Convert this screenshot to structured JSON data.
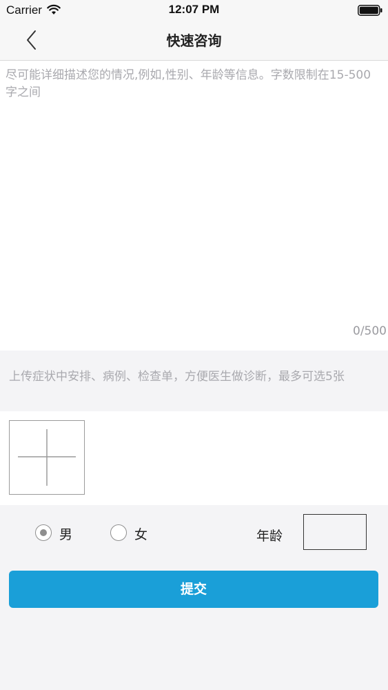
{
  "status_bar": {
    "carrier": "Carrier",
    "time": "12:07 PM"
  },
  "nav": {
    "title": "快速咨询"
  },
  "description": {
    "placeholder": "尽可能详细描述您的情况,例如,性别、年龄等信息。字数限制在15-500字之间",
    "counter": "0/500"
  },
  "upload": {
    "hint": "上传症状中安排、病例、检查单，方便医生做诊断，最多可选5张"
  },
  "form": {
    "gender_options": [
      {
        "label": "男",
        "selected": true
      },
      {
        "label": "女",
        "selected": false
      }
    ],
    "age_label": "年龄",
    "age_value": ""
  },
  "submit_label": "提交",
  "colors": {
    "accent": "#1a9fd8",
    "background": "#f4f4f6",
    "placeholder": "#a9a9ae"
  }
}
